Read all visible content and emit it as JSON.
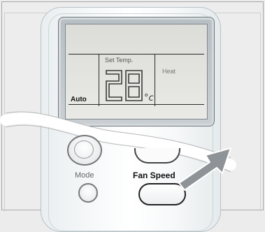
{
  "lcd": {
    "set_temp_label": "Set Temp.",
    "temperature": "28",
    "unit": "°c",
    "mode_indicator": "Auto",
    "mode_text": "Heat"
  },
  "buttons": {
    "mode_label": "Mode",
    "fan_speed_label": "Fan Speed"
  },
  "colors": {
    "lcd_background": "#e4e4e0",
    "remote_body": "#f4f6f7",
    "pointer_arrow": "#8d9396"
  },
  "icons": {
    "power": "power-icon",
    "pointer": "pointer-arrow-icon"
  }
}
